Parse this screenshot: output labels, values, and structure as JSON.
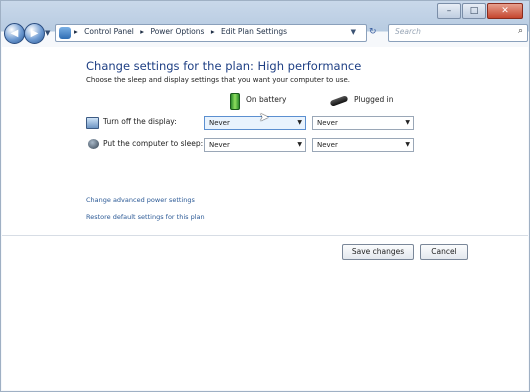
{
  "window": {
    "controls": {
      "minimize": "–",
      "maximize": "□",
      "close": "✕"
    }
  },
  "address": {
    "back_glyph": "◀",
    "forward_glyph": "▶",
    "breadcrumbs": [
      "Control Panel",
      "Power Options",
      "Edit Plan Settings"
    ],
    "separator": "▸",
    "dropdown_glyph": "▼",
    "refresh_glyph": "↻",
    "search_placeholder": "Search",
    "search_glyph": "⌕"
  },
  "page": {
    "title": "Change settings for the plan: High performance",
    "subtitle": "Choose the sleep and display settings that you want your computer to use."
  },
  "columns": {
    "battery": "On battery",
    "plugged_in": "Plugged in"
  },
  "settings": [
    {
      "label": "Turn off the display:",
      "on_battery": "Never",
      "plugged_in": "Never"
    },
    {
      "label": "Put the computer to sleep:",
      "on_battery": "Never",
      "plugged_in": "Never"
    }
  ],
  "links": {
    "advanced": "Change advanced power settings",
    "restore": "Restore default settings for this plan"
  },
  "buttons": {
    "save": "Save changes",
    "cancel": "Cancel"
  },
  "select_arrow": "▼",
  "cursor_glyph": "➤"
}
